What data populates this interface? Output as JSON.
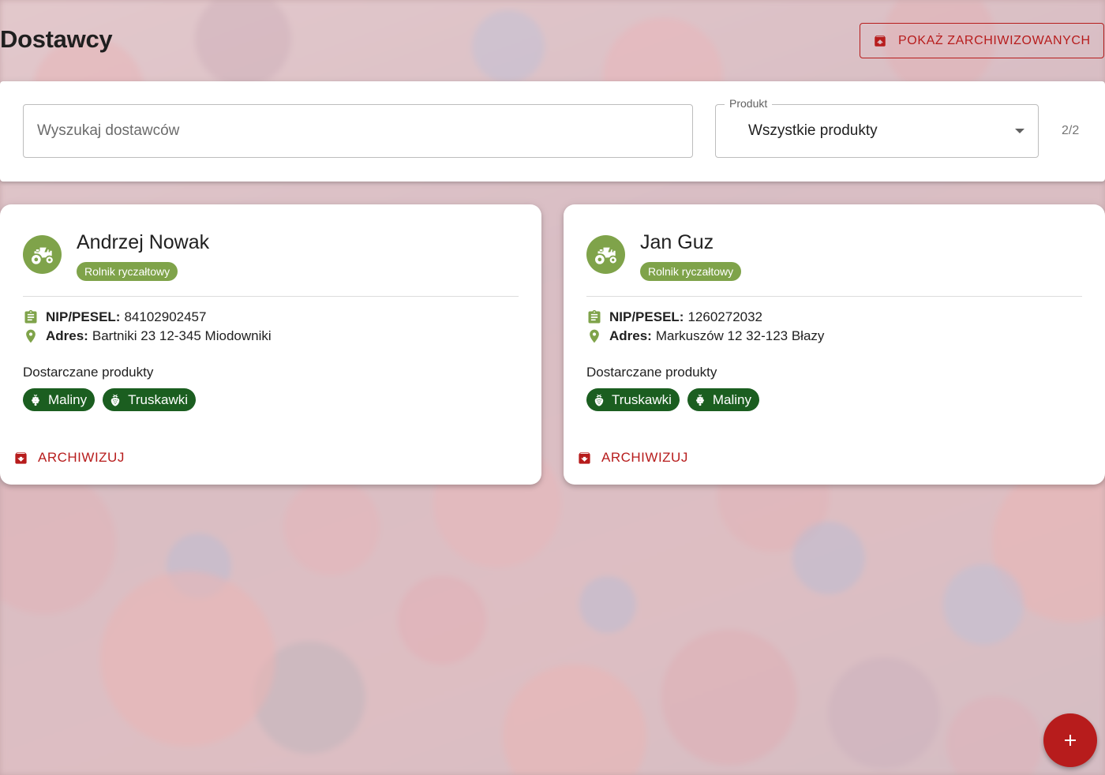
{
  "header": {
    "title": "Dostawcy",
    "archived_button_label": "POKAŻ ZARCHIWIZOWANYCH"
  },
  "filters": {
    "search_placeholder": "Wyszukaj dostawców",
    "product_label": "Produkt",
    "product_value": "Wszystkie produkty",
    "count": "2/2"
  },
  "suppliers": [
    {
      "name": "Andrzej Nowak",
      "type": "Rolnik ryczałtowy",
      "nip_label": "NIP/PESEL:",
      "nip_value": "84102902457",
      "address_label": "Adres:",
      "address_value": "Bartniki 23 12-345 Miodowniki",
      "products_heading": "Dostarczane produkty",
      "products": [
        "Maliny",
        "Truskawki"
      ],
      "archive_label": "ARCHIWIZUJ"
    },
    {
      "name": "Jan Guz",
      "type": "Rolnik ryczałtowy",
      "nip_label": "NIP/PESEL:",
      "nip_value": "1260272032",
      "address_label": "Adres:",
      "address_value": "Markuszów 12 32-123 Błazy",
      "products_heading": "Dostarczane produkty",
      "products": [
        "Truskawki",
        "Maliny"
      ],
      "archive_label": "ARCHIWIZUJ"
    }
  ],
  "icons": {
    "archived": "unarchive-icon",
    "avatar": "tractor-icon",
    "nip": "clipboard-icon",
    "address": "location-pin-icon",
    "raspberry": "raspberry-icon",
    "strawberry": "strawberry-icon",
    "archive": "archive-icon",
    "fab": "plus-icon"
  },
  "colors": {
    "accent_red": "#b71c1c",
    "avatar_green": "#7fa34a",
    "chip_green": "#1b5e20"
  }
}
